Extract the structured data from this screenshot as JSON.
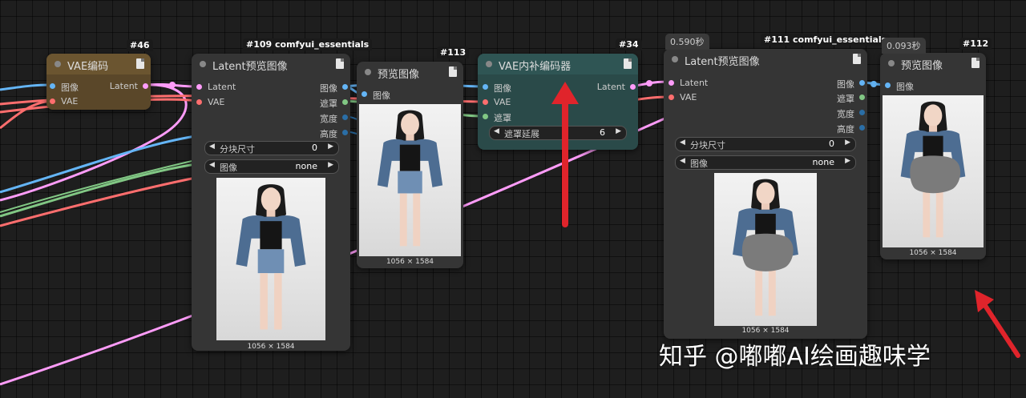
{
  "nodes": {
    "vae_encode": {
      "title": "VAE编码",
      "in": [
        "图像",
        "VAE"
      ],
      "out": [
        "Latent"
      ],
      "color": "#5a4729",
      "id": "#46"
    },
    "latent_preview_1": {
      "id": "#109 comfyui_essentials",
      "title": "Latent预览图像",
      "in": [
        "Latent",
        "VAE"
      ],
      "out": [
        "图像",
        "遮罩",
        "宽度",
        "高度"
      ],
      "widgets": [
        {
          "label": "分块尺寸",
          "value": "0"
        },
        {
          "label": "图像",
          "value": "none"
        }
      ],
      "dims": "1056 × 1584"
    },
    "preview_1": {
      "id": "#113",
      "title": "预览图像",
      "in": [
        "图像"
      ],
      "dims": "1056 × 1584"
    },
    "vae_inpaint": {
      "id": "#34",
      "title": "VAE内补编码器",
      "in": [
        "图像",
        "VAE",
        "遮罩"
      ],
      "out": [
        "Latent"
      ],
      "widget": {
        "label": "遮罩延展",
        "value": "6"
      },
      "color": "#2a4a49"
    },
    "latent_preview_2": {
      "time": "0.590秒",
      "id": "#111 comfyui_essentials",
      "title": "Latent预览图像",
      "in": [
        "Latent",
        "VAE"
      ],
      "out": [
        "图像",
        "遮罩",
        "宽度",
        "高度"
      ],
      "widgets": [
        {
          "label": "分块尺寸",
          "value": "0"
        },
        {
          "label": "图像",
          "value": "none"
        }
      ],
      "dims": "1056 × 1584"
    },
    "preview_2": {
      "time": "0.093秒",
      "id": "#112",
      "title": "预览图像",
      "in": [
        "图像"
      ],
      "dims": "1056 × 1584"
    }
  },
  "colors": {
    "image": "#64b5f6",
    "vae": "#ff6e6e",
    "latent": "#ff9cf9",
    "mask": "#81c784",
    "int": "#2a6ea6",
    "arrow": "#e0242b"
  },
  "watermark": "知乎 @嘟嘟AI绘画趣味学"
}
